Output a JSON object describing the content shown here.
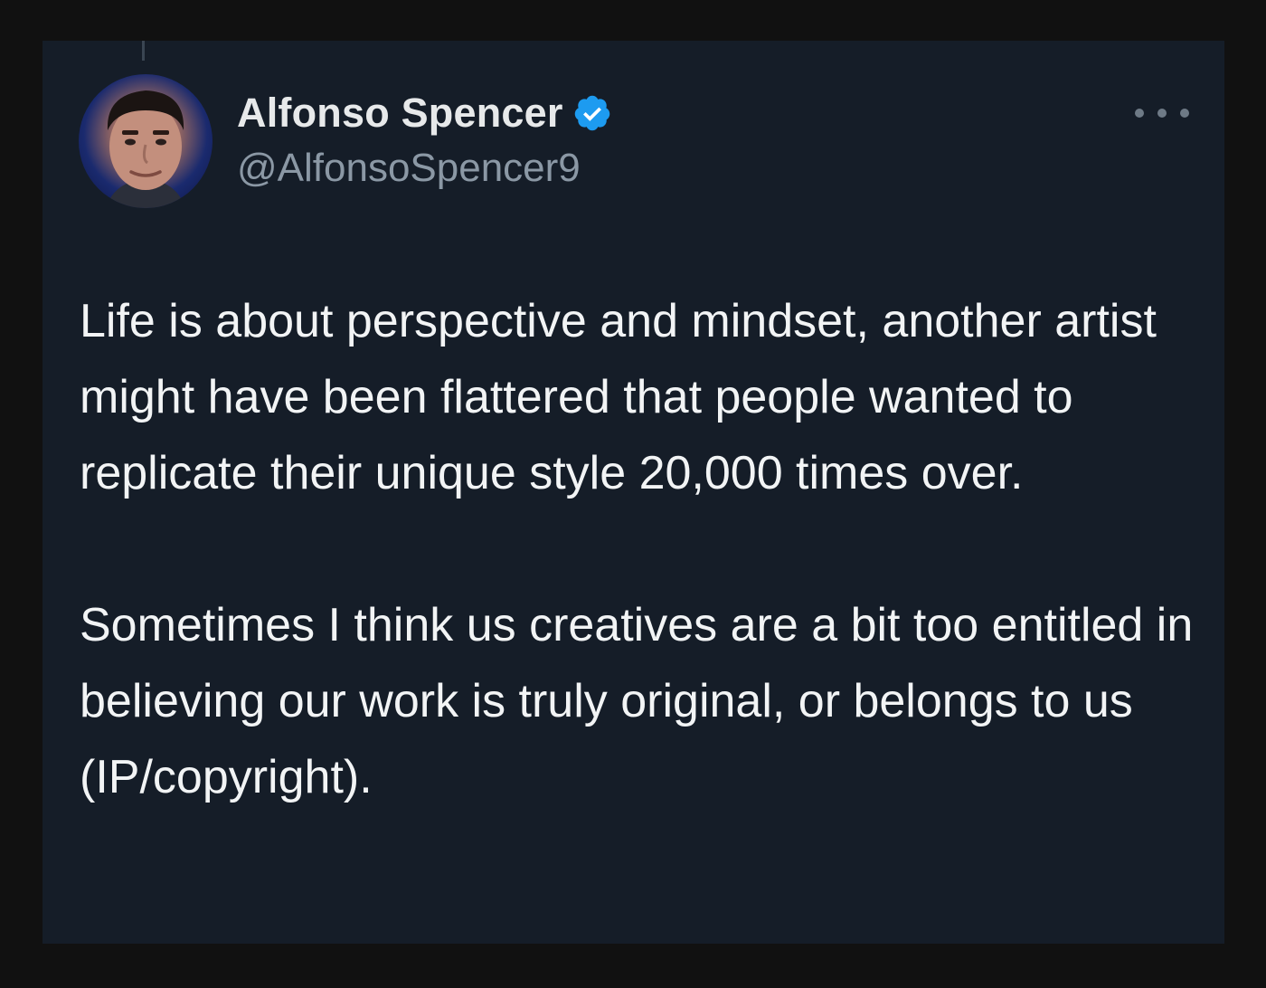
{
  "tweet": {
    "author": {
      "display_name": "Alfonso Spencer",
      "handle": "@AlfonsoSpencer9",
      "verified": true,
      "avatar_icon": "profile-photo"
    },
    "more_icon": "ellipsis-icon",
    "paragraphs": [
      "Life is about perspective and mindset, another artist might have been flattered that people wanted to replicate their unique style 20,000 times over.",
      "Sometimes I think us creatives are a bit too entitled in believing our work is truly original, or belongs to us (IP/copyright)."
    ]
  },
  "colors": {
    "card_background": "#151d28",
    "page_background": "#111111",
    "verified_badge": "#1d9bf0",
    "primary_text": "#e7e9ea",
    "secondary_text": "#8b98a5"
  }
}
